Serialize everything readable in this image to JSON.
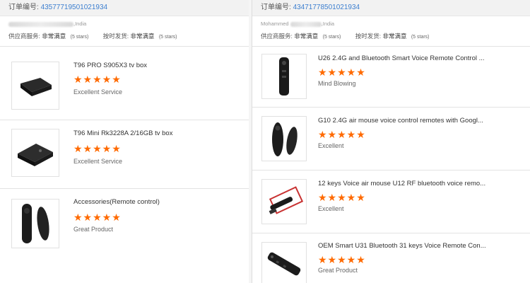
{
  "colors": {
    "link": "#3d7fcf",
    "star": "#ff6a00",
    "bar": "#f2f2f2"
  },
  "left": {
    "order_label": "订单编号:",
    "order_number": "43577719501021934",
    "buyer_country": "India",
    "supplier_label": "供应商服务:",
    "supplier_value": "非常满意",
    "supplier_stars": "(5 stars)",
    "shipping_label": "按时发货:",
    "shipping_value": "非常满意",
    "shipping_stars": "(5 stars)",
    "items": [
      {
        "title": "T96 PRO S905X3 tv box",
        "stars": "★★★★★",
        "comment": "Excellent Service",
        "icon": "tv-box-image"
      },
      {
        "title": "T96 Mini Rk3228A 2/16GB tv box",
        "stars": "★★★★★",
        "comment": "Excellent Service",
        "icon": "tv-box-image"
      },
      {
        "title": "Accessories(Remote control)",
        "stars": "★★★★★",
        "comment": "Great Product",
        "icon": "remote-control-image"
      }
    ]
  },
  "right": {
    "order_label": "订单编号:",
    "order_number": "43471778501021934",
    "buyer_name": "Mohammed",
    "buyer_country": "India",
    "supplier_label": "供应商服务:",
    "supplier_value": "非常满意",
    "supplier_stars": "(5 stars)",
    "shipping_label": "按时发货:",
    "shipping_value": "非常满意",
    "shipping_stars": "(5 stars)",
    "items": [
      {
        "title": "U26 2.4G and Bluetooth Smart Voice Remote Control ...",
        "stars": "★★★★★",
        "comment": "Mind Blowing",
        "icon": "remote-control-image"
      },
      {
        "title": "G10 2.4G air mouse voice control remotes with Googl...",
        "stars": "★★★★★",
        "comment": "Excellent",
        "icon": "air-mouse-remote-image"
      },
      {
        "title": "12 keys Voice air mouse U12 RF bluetooth voice remo...",
        "stars": "★★★★★",
        "comment": "Excellent",
        "icon": "remote-box-image"
      },
      {
        "title": "OEM Smart U31 Bluetooth 31 keys Voice Remote Con...",
        "stars": "★★★★★",
        "comment": "Great Product",
        "icon": "remote-control-image"
      }
    ]
  }
}
